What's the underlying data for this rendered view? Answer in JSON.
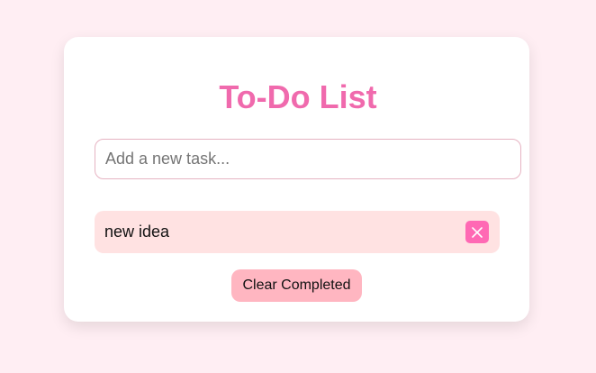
{
  "app": {
    "title": "To-Do List"
  },
  "new_task": {
    "placeholder": "Add a new task...",
    "value": ""
  },
  "tasks": [
    {
      "label": "new idea",
      "delete_icon": "close-icon"
    }
  ],
  "actions": {
    "clear_completed_label": "Clear Completed"
  },
  "colors": {
    "background": "#ffeef3",
    "title": "#f06aad",
    "task_item": "#ffe2e2",
    "delete_button": "#ff69b4",
    "clear_button": "#ffb6c1"
  }
}
